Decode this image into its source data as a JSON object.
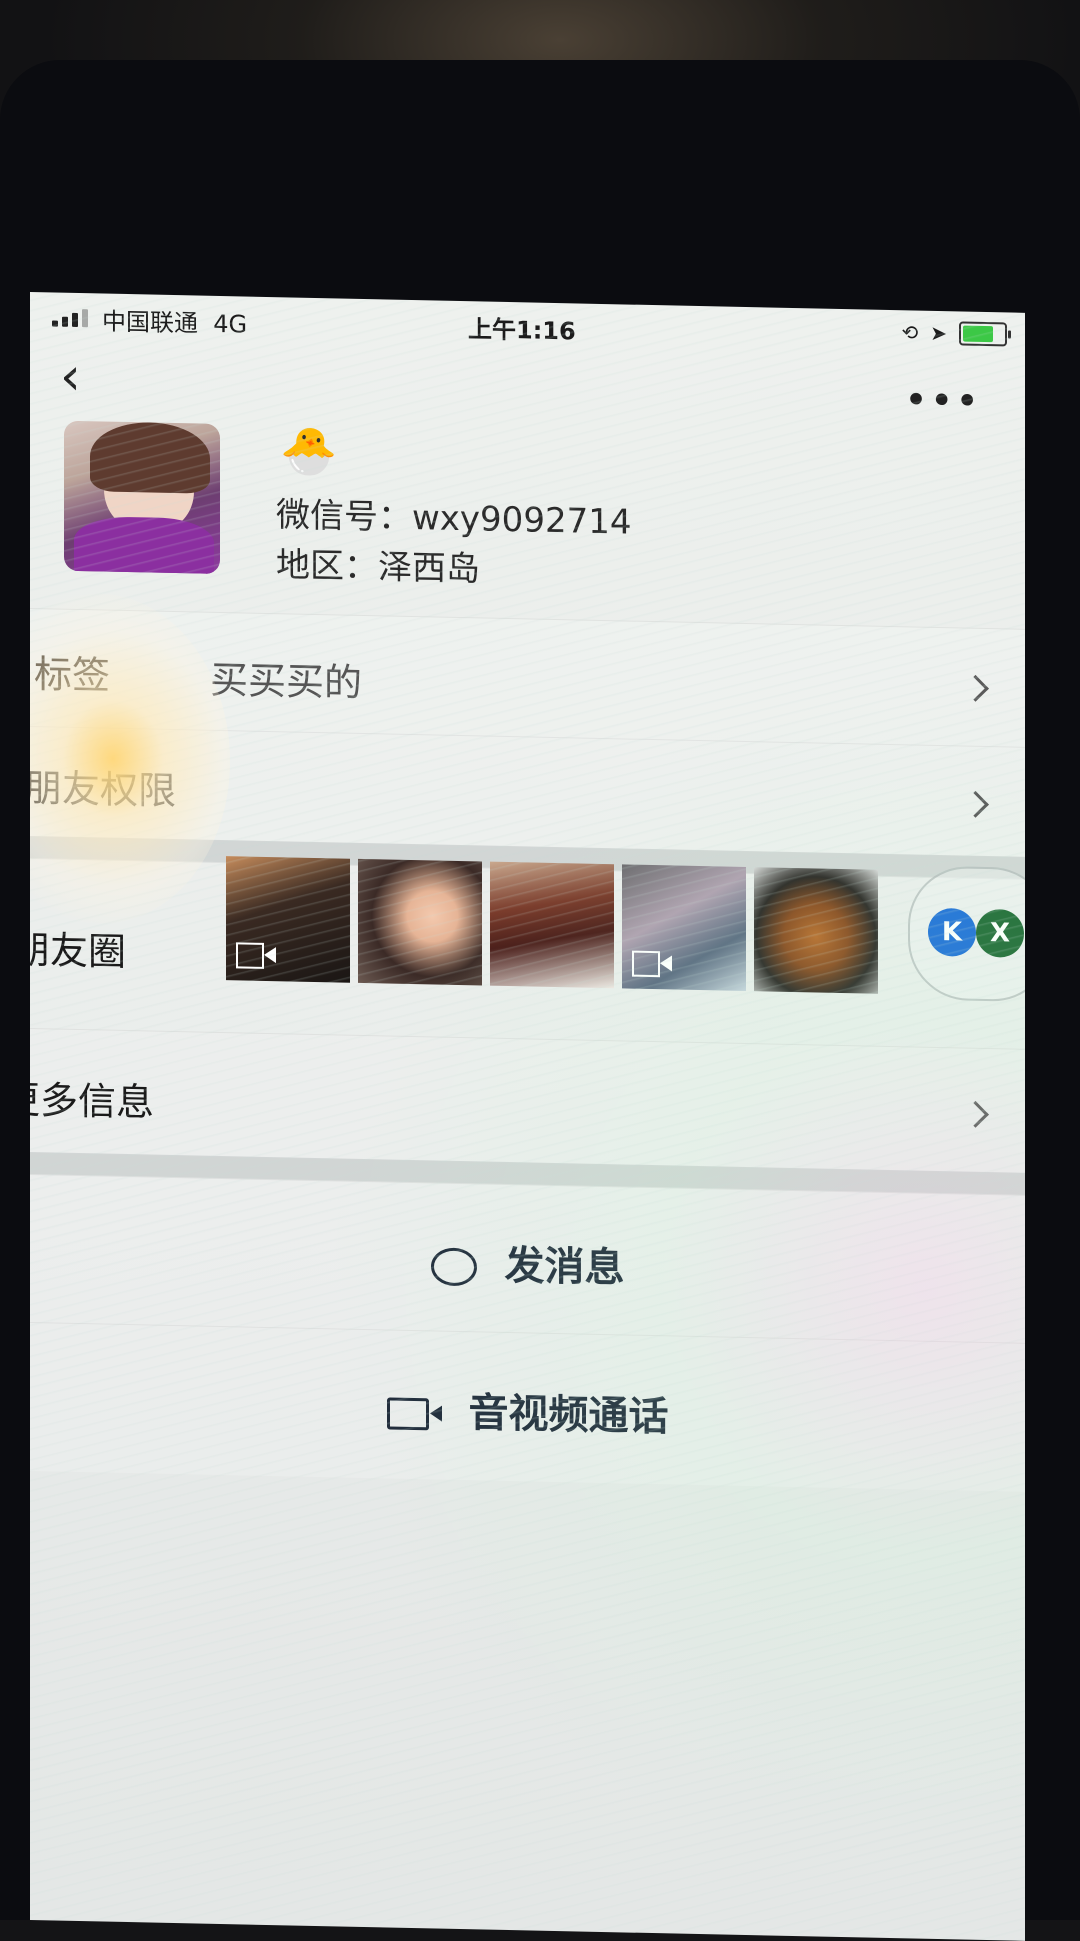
{
  "status_bar": {
    "carrier": "中国联通",
    "network": "4G",
    "time": "上午1:16"
  },
  "nav": {
    "back_icon": "chevron-left-icon",
    "more_label": "•••"
  },
  "profile": {
    "emoji": "🐣",
    "wechat_id": "微信号：wxy9092714",
    "region": "地区：泽西岛"
  },
  "rows": {
    "tags": {
      "label": "标签",
      "value": "买买买的"
    },
    "permissions": {
      "label": "朋友权限"
    },
    "moments": {
      "label": "朋友圈"
    },
    "more_info": {
      "label": "更多信息"
    }
  },
  "float_widget": {
    "left_label": "K",
    "right_label": "X"
  },
  "actions": {
    "message": "发消息",
    "call": "音视频通话"
  },
  "colors": {
    "label_text": "#1a1a1a",
    "action_text": "#1f2a3a",
    "battery": "#3cc846"
  }
}
